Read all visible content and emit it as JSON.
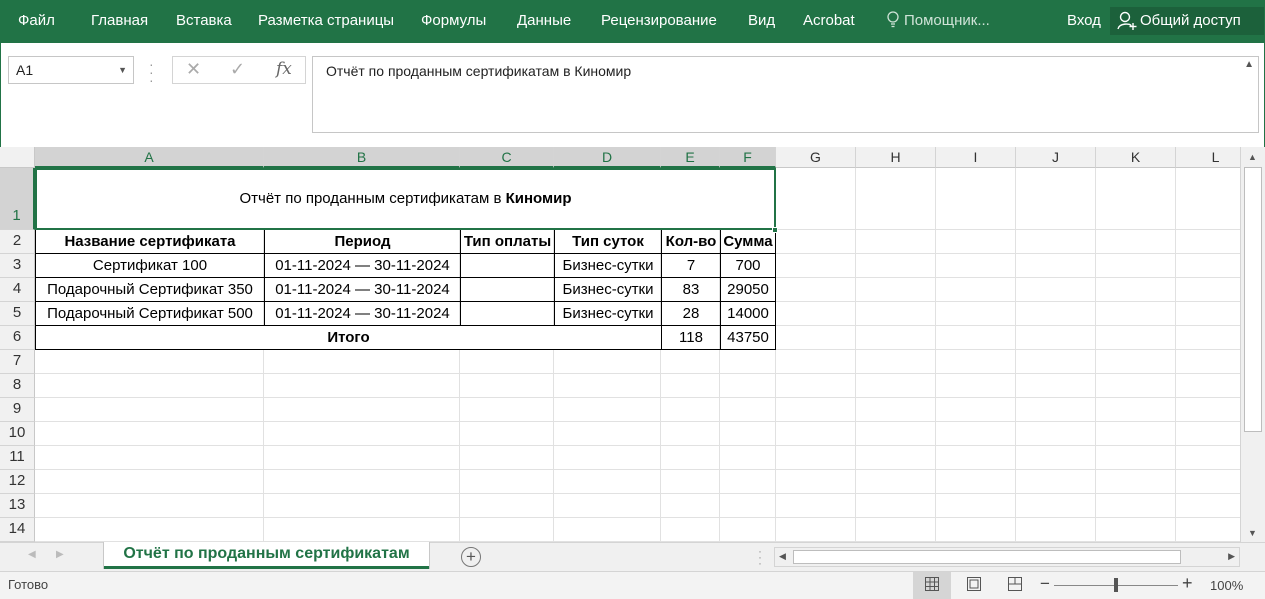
{
  "ribbon": {
    "tabs": [
      {
        "label": "Файл"
      },
      {
        "label": "Главная"
      },
      {
        "label": "Вставка"
      },
      {
        "label": "Разметка страницы"
      },
      {
        "label": "Формулы"
      },
      {
        "label": "Данные"
      },
      {
        "label": "Рецензирование"
      },
      {
        "label": "Вид"
      },
      {
        "label": "Acrobat"
      }
    ],
    "tell_me": "Помощник...",
    "sign_in": "Вход",
    "share": "Общий доступ"
  },
  "formula_bar": {
    "name_box": "A1",
    "fx": "fx",
    "content": "Отчёт по проданным сертификатам в Киномир"
  },
  "columns": [
    "A",
    "B",
    "C",
    "D",
    "E",
    "F",
    "G",
    "H",
    "I",
    "J",
    "K",
    "L"
  ],
  "rows": [
    "1",
    "2",
    "3",
    "4",
    "5",
    "6",
    "7",
    "8",
    "9",
    "10",
    "11",
    "12",
    "13",
    "14"
  ],
  "sheet": {
    "title_prefix": "Отчёт по проданным сертификатам в ",
    "title_bold": "Киномир",
    "headers": [
      "Название сертификата",
      "Период",
      "Тип оплаты",
      "Тип суток",
      "Кол-во",
      "Сумма"
    ],
    "data_rows": [
      [
        "Сертификат 100",
        "01-11-2024 — 30-11-2024",
        "",
        "Бизнес-сутки",
        "7",
        "700"
      ],
      [
        "Подарочный Сертификат 350",
        "01-11-2024 — 30-11-2024",
        "",
        "Бизнес-сутки",
        "83",
        "29050"
      ],
      [
        "Подарочный Сертификат 500",
        "01-11-2024 — 30-11-2024",
        "",
        "Бизнес-сутки",
        "28",
        "14000"
      ]
    ],
    "total_label": "Итого",
    "total_qty": "118",
    "total_sum": "43750"
  },
  "sheet_tabs": [
    {
      "label": "Отчёт по проданным сертификатам",
      "active": true
    }
  ],
  "status_bar": {
    "ready": "Готово",
    "zoom_label": "100%",
    "zoom_level_percent": 100
  },
  "colors": {
    "accent": "#217346"
  }
}
